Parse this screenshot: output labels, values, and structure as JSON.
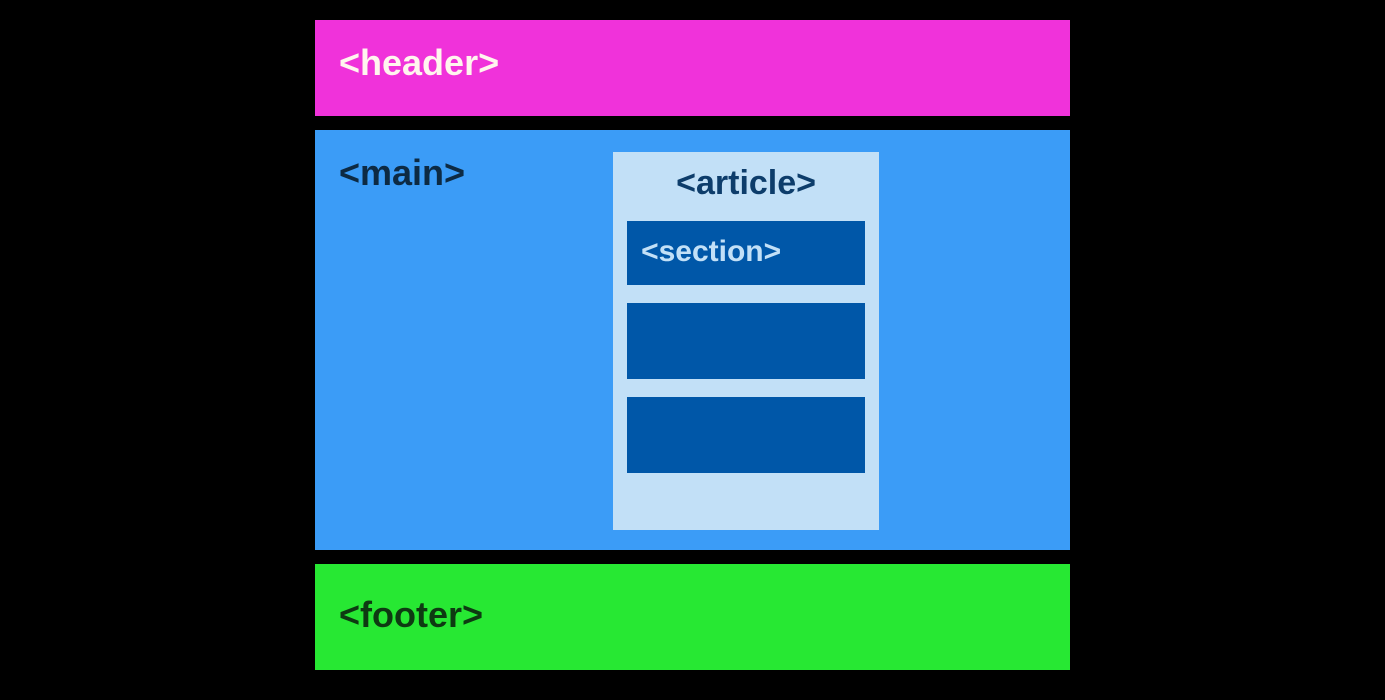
{
  "header": {
    "label": "<header>"
  },
  "main": {
    "label": "<main>",
    "article": {
      "label": "<article>",
      "sections": [
        {
          "label": "<section>"
        },
        {
          "label": ""
        },
        {
          "label": ""
        }
      ]
    }
  },
  "footer": {
    "label": "<footer>"
  },
  "colors": {
    "header_bg": "#f032da",
    "main_bg": "#3b9cf7",
    "article_bg": "#c2e0f7",
    "section_bg": "#0057a8",
    "footer_bg": "#27e833"
  }
}
